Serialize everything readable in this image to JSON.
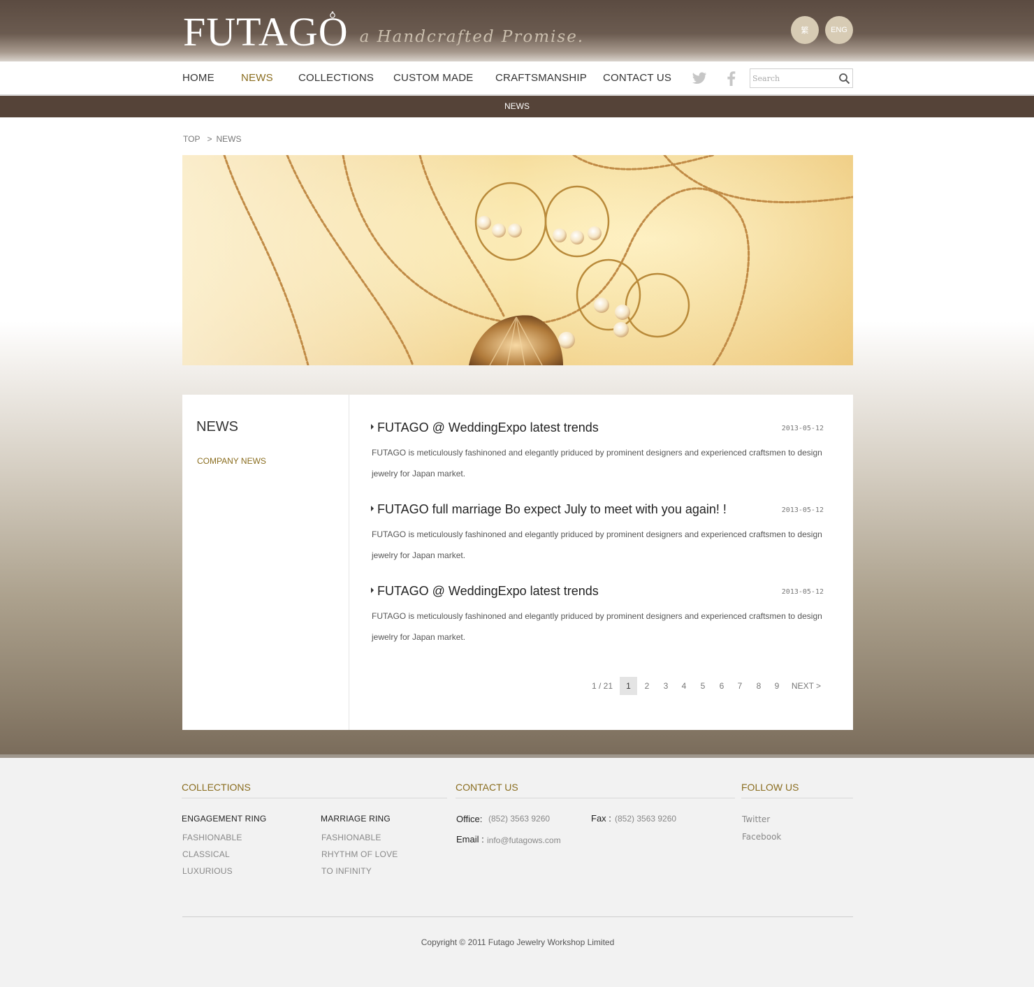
{
  "header": {
    "logo_text": "FUTAGO",
    "tagline": "a Handcrafted Promise.",
    "lang_zh": "繁",
    "lang_en": "ENG"
  },
  "nav": {
    "items": [
      {
        "label": "HOME",
        "active": false
      },
      {
        "label": "NEWS",
        "active": true
      },
      {
        "label": "COLLECTIONS",
        "active": false
      },
      {
        "label": "CUSTOM MADE",
        "active": false
      },
      {
        "label": "CRAFTSMANSHIP",
        "active": false
      },
      {
        "label": "CONTACT US",
        "active": false
      }
    ],
    "social_icons": [
      "twitter-icon",
      "facebook-icon"
    ],
    "search_placeholder": "Search"
  },
  "section_bar": {
    "title": "NEWS"
  },
  "breadcrumb": {
    "top": "TOP",
    "separator": ">",
    "current": "NEWS"
  },
  "sidebar": {
    "title": "NEWS",
    "links": [
      "COMPANY NEWS"
    ]
  },
  "news": [
    {
      "title": "FUTAGO @ WeddingExpo latest trends",
      "date": "2013-05-12",
      "desc": "FUTAGO is meticulously fashinoned and elegantly priduced by prominent designers and experienced craftsmen to design jewelry for Japan market."
    },
    {
      "title": "FUTAGO full marriage Bo expect July to meet with you again! !",
      "date": "2013-05-12",
      "desc": "FUTAGO is meticulously fashinoned and elegantly priduced by prominent designers and experienced craftsmen to design jewelry for Japan market."
    },
    {
      "title": "FUTAGO @ WeddingExpo latest trends",
      "date": "2013-05-12",
      "desc": "FUTAGO is meticulously fashinoned and elegantly priduced by prominent designers and experienced craftsmen to design jewelry for Japan market."
    }
  ],
  "pager": {
    "summary": "1 / 21",
    "pages": [
      "1",
      "2",
      "3",
      "4",
      "5",
      "6",
      "7",
      "8",
      "9"
    ],
    "current": "1",
    "next": "NEXT >"
  },
  "footer": {
    "collections": {
      "heading": "COLLECTIONS",
      "engagement": {
        "title": "ENGAGEMENT RING",
        "links": [
          "FASHIONABLE",
          "CLASSICAL",
          "LUXURIOUS"
        ]
      },
      "marriage": {
        "title": "MARRIAGE RING",
        "links": [
          "FASHIONABLE",
          "RHYTHM OF LOVE",
          "TO INFINITY"
        ]
      }
    },
    "contact": {
      "heading": "CONTACT US",
      "office_label": "Office:",
      "office_value": "(852) 3563 9260",
      "fax_label": "Fax :",
      "fax_value": "(852) 3563 9260",
      "email_label": "Email :",
      "email_value": "info@futagows.com"
    },
    "follow": {
      "heading": "FOLLOW US",
      "links": [
        "Twitter",
        "Facebook"
      ]
    },
    "copyright": "Copyright © 2011 Futago Jewelry Workshop Limited"
  },
  "colors": {
    "header_brown": "#5b4b41",
    "accent_gold": "#8a6d1f",
    "section_bar": "#554338",
    "lang_button": "#d7cbb4"
  }
}
